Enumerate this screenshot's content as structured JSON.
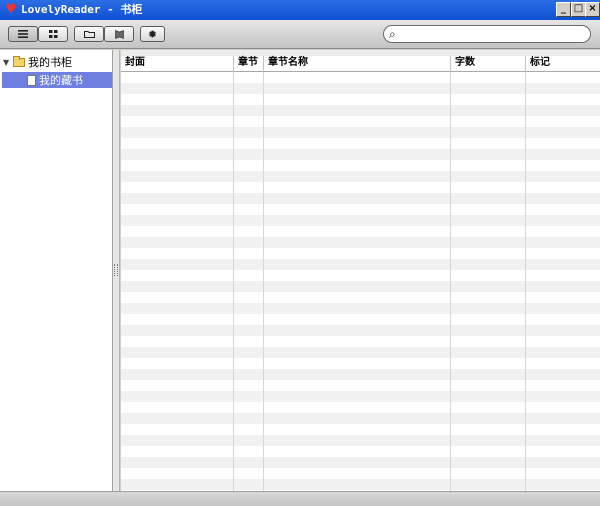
{
  "window": {
    "title": "LovelyReader - 书柜",
    "icon": "heart-app-icon",
    "controls": [
      "minimize",
      "maximize",
      "close"
    ]
  },
  "toolbar": {
    "buttons": [
      {
        "name": "list-view-button",
        "icon": "list-icon"
      },
      {
        "name": "grid-view-button",
        "icon": "grid-icon"
      },
      {
        "name": "folder-button",
        "icon": "folder-icon"
      },
      {
        "name": "bookmark-button",
        "icon": "book-icon"
      },
      {
        "name": "settings-button",
        "icon": "gear-icon"
      }
    ],
    "search": {
      "value": "",
      "placeholder": "",
      "icon": "search-icon"
    }
  },
  "sidebar": {
    "root": {
      "label": "我的书柜",
      "expanded": true
    },
    "items": [
      {
        "label": "我的藏书",
        "selected": true
      }
    ]
  },
  "table": {
    "columns": [
      "封面",
      "章节",
      "章节名称",
      "字数",
      "标记"
    ],
    "rows": []
  },
  "colors": {
    "titlebar": "#0f4fd1",
    "selection": "#6e7fe0"
  }
}
